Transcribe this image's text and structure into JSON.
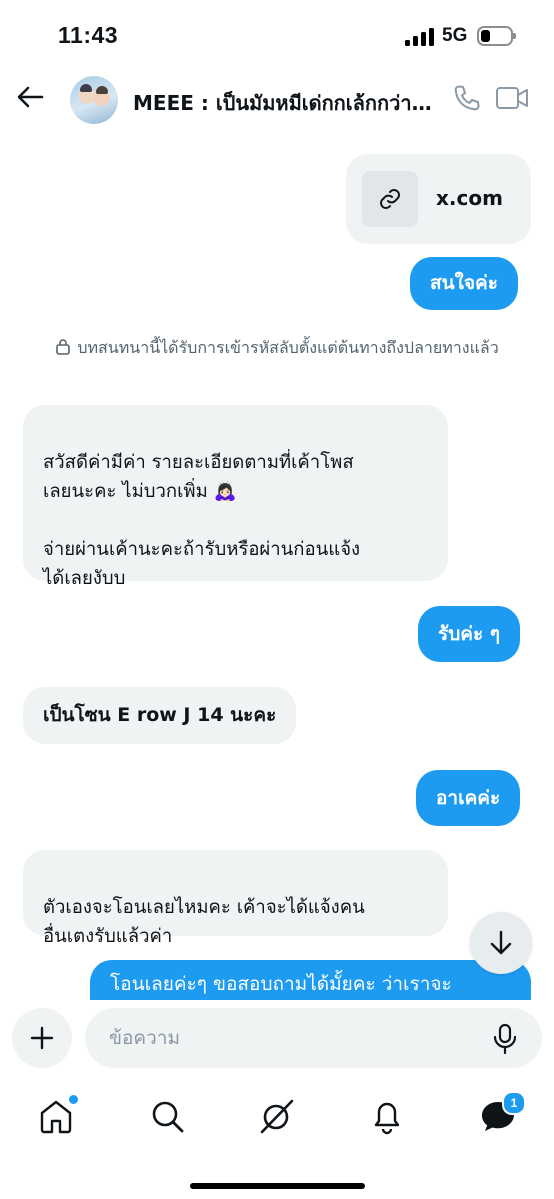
{
  "status": {
    "time": "11:43",
    "network": "5G"
  },
  "header": {
    "title": "MEEE : เป็นมัมหมีเด่กกเล้กกว่าแม่เลี้ยงเดี่ยว",
    "icons": {
      "back": "arrow-left-icon",
      "call": "phone-icon",
      "video": "video-camera-icon"
    }
  },
  "messages": {
    "link_card": {
      "domain": "x.com",
      "icon": "link-icon"
    },
    "m1": "สนใจค่ะ",
    "encryption_note": "บทสนทนานี้ได้รับการเข้ารหัสลับตั้งแต่ต้นทางถึงปลายทางแล้ว",
    "m2": "สวัสดีค่ามีค่า รายละเอียดตามที่เค้าโพส\nเลยนะคะ ไม่บวกเพิ่ม 🙇🏻‍♀️\n\nจ่ายผ่านเค้านะคะถ้ารับหรือผ่านก่อนแจ้ง\nได้เลยงับบ",
    "m3": "รับค่ะ ๆ",
    "m4": "เป็นโซน E row J 14 นะคะ",
    "m5": "อาเคค่ะ",
    "m6": "ตัวเองจะโอนเลยไหมคะ เค้าจะได้แจ้งคน\nอื่นเตงรับแล้วค่า",
    "m7": "โอนเลยค่ะๆ ขอสอบถามได้มั้ยคะ ว่าเราจะ"
  },
  "composer": {
    "placeholder": "ข้อความ",
    "icons": {
      "add": "plus-icon",
      "mic": "microphone-icon"
    }
  },
  "bottom_nav": {
    "items": [
      "home-icon",
      "search-icon",
      "grok-icon",
      "notifications-icon",
      "messages-icon"
    ],
    "messages_badge": "1"
  },
  "colors": {
    "accent": "#1d9bf0",
    "bubble_received": "#eff3f4",
    "text": "#0f1419",
    "muted": "#536471"
  }
}
